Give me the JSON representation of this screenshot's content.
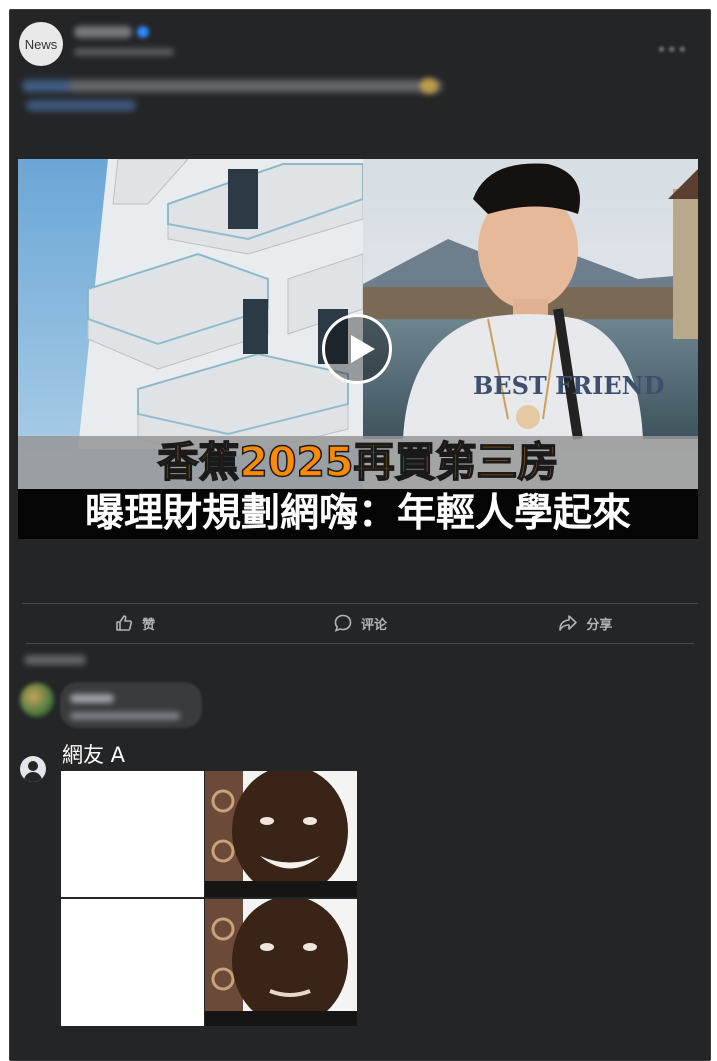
{
  "post": {
    "page_avatar_text": "News",
    "video_title_line1": "香蕉2025再買第三房",
    "video_title_line2": "曝理財規劃網嗨：年輕人學起來"
  },
  "actions": {
    "like_label": "赞",
    "comment_label": "评论",
    "share_label": "分享"
  },
  "reply": {
    "author": "網友 A"
  },
  "colors": {
    "card_bg": "#242526",
    "title_orange": "#ff8a00",
    "action_text": "#b0b3b8"
  },
  "icons": {
    "like": "thumbs-up-icon",
    "comment": "speech-bubble-icon",
    "share": "share-arrow-icon",
    "play": "play-icon",
    "user": "user-avatar-icon"
  }
}
